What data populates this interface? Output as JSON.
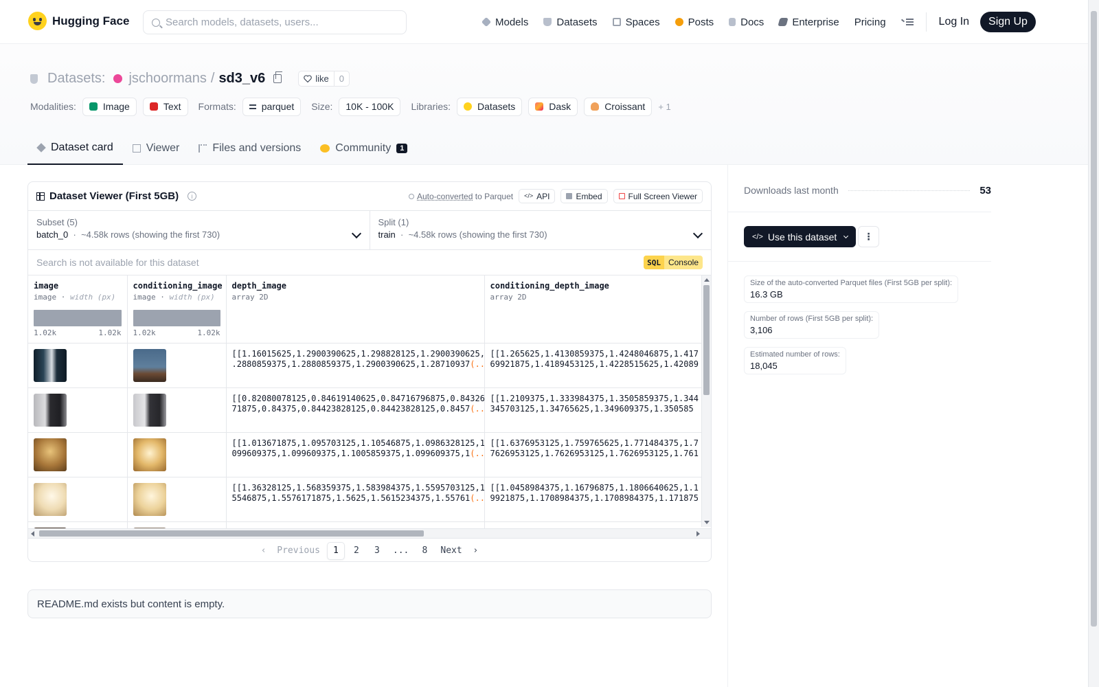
{
  "brand": {
    "name": "Hugging Face"
  },
  "search": {
    "placeholder": "Search models, datasets, users..."
  },
  "nav": {
    "items": [
      {
        "label": "Models",
        "icon": "models-icon"
      },
      {
        "label": "Datasets",
        "icon": "datasets-icon"
      },
      {
        "label": "Spaces",
        "icon": "spaces-icon"
      },
      {
        "label": "Posts",
        "icon": "posts-icon"
      },
      {
        "label": "Docs",
        "icon": "docs-icon"
      },
      {
        "label": "Enterprise",
        "icon": "enterprise-icon"
      },
      {
        "label": "Pricing"
      }
    ],
    "login": "Log In",
    "signup": "Sign Up"
  },
  "repo": {
    "kind": "Datasets:",
    "owner": "jschoormans",
    "separator": "/",
    "name": "sd3_v6",
    "like_label": "like",
    "like_count": "0"
  },
  "meta": {
    "modalities_label": "Modalities:",
    "modalities": [
      "Image",
      "Text"
    ],
    "formats_label": "Formats:",
    "formats": [
      "parquet"
    ],
    "size_label": "Size:",
    "size": "10K - 100K",
    "libraries_label": "Libraries:",
    "libraries": [
      "Datasets",
      "Dask",
      "Croissant"
    ],
    "more": "+ 1"
  },
  "tabs": [
    {
      "label": "Dataset card",
      "active": true
    },
    {
      "label": "Viewer"
    },
    {
      "label": "Files and versions"
    },
    {
      "label": "Community",
      "badge": "1"
    }
  ],
  "viewer": {
    "title": "Dataset Viewer (First 5GB)",
    "info": "i",
    "auto_converted": "Auto-converted",
    "to_parquet": "to Parquet",
    "api": "API",
    "embed": "Embed",
    "full_screen": "Full Screen Viewer",
    "subset_label": "Subset (5)",
    "subset_value": "batch_0",
    "subset_rows": "~4.58k rows (showing the first 730)",
    "split_label": "Split (1)",
    "split_value": "train",
    "split_rows": "~4.58k rows (showing the first 730)",
    "search_placeholder": "Search is not available for this dataset",
    "sql": "SQL",
    "console": "Console",
    "columns": [
      {
        "name": "image",
        "type": "image",
        "sub": "width (px)",
        "hist_min": "1.02k",
        "hist_max": "1.02k"
      },
      {
        "name": "conditioning_image",
        "type": "image",
        "sub": "width (px)",
        "hist_min": "1.02k",
        "hist_max": "1.02k"
      },
      {
        "name": "depth_image",
        "type": "array 2D"
      },
      {
        "name": "conditioning_depth_image",
        "type": "array 2D"
      }
    ],
    "rows": [
      {
        "depth_l1": "[[1.16015625,1.2900390625,1.298828125,1.2900390625,1",
        "depth_l2": ".2880859375,1.2880859375,1.2900390625,1.28710937",
        "cond_l1": "[[1.265625,1.4130859375,1.4248046875,1.417",
        "cond_l2": "69921875,1.4189453125,1.4228515625,1.42089"
      },
      {
        "depth_l1": "[[0.82080078125,0.84619140625,0.84716796875,0.843261",
        "depth_l2": "71875,0.84375,0.84423828125,0.84423828125,0.8457",
        "cond_l1": "[[1.2109375,1.333984375,1.3505859375,1.344",
        "cond_l2": "345703125,1.34765625,1.349609375,1.350585"
      },
      {
        "depth_l1": "[[1.013671875,1.095703125,1.10546875,1.0986328125,1.",
        "depth_l2": "099609375,1.099609375,1.1005859375,1.099609375,1",
        "cond_l1": "[[1.6376953125,1.759765625,1.771484375,1.7",
        "cond_l2": "7626953125,1.7626953125,1.7626953125,1.761"
      },
      {
        "depth_l1": "[[1.36328125,1.568359375,1.583984375,1.5595703125,1.",
        "depth_l2": "5546875,1.5576171875,1.5625,1.5615234375,1.55761",
        "cond_l1": "[[1.0458984375,1.16796875,1.1806640625,1.1",
        "cond_l2": "9921875,1.1708984375,1.1708984375,1.171875"
      }
    ],
    "ellipsis": "(...)",
    "pager": {
      "previous": "Previous",
      "pages": [
        "1",
        "2",
        "3",
        "...",
        "8"
      ],
      "next": "Next",
      "current": "1"
    }
  },
  "readme": "README.md exists but content is empty.",
  "sidebar": {
    "downloads_label": "Downloads last month",
    "downloads_value": "53",
    "use_dataset": "Use this dataset",
    "kebab": "⋮",
    "stats": [
      {
        "label": "Size of the auto-converted Parquet files (First 5GB per split):",
        "value": "16.3 GB"
      },
      {
        "label": "Number of rows (First 5GB per split):",
        "value": "3,106"
      },
      {
        "label": "Estimated number of rows:",
        "value": "18,045"
      }
    ]
  },
  "colors": {
    "accent_dark": "#111827",
    "hf_yellow": "#ffd21e",
    "sql_yellow": "#fde68a",
    "ellipsis_orange": "#f97316"
  }
}
